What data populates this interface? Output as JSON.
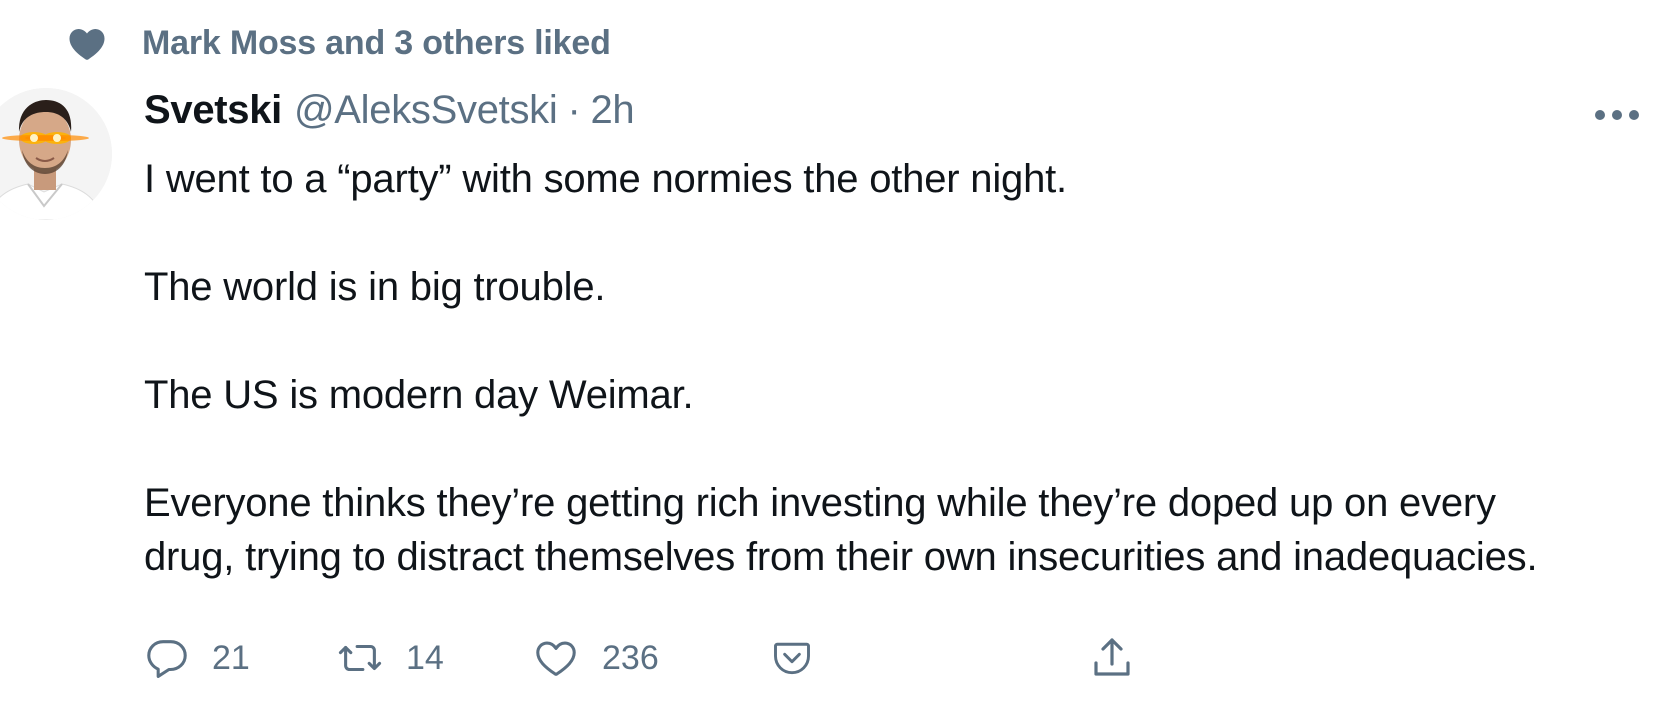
{
  "social_context": {
    "icon": "heart-icon",
    "text": "Mark Moss and 3 others liked"
  },
  "author": {
    "display_name": "Svetski",
    "handle": "@AleksSvetski",
    "separator": "·",
    "time": "2h"
  },
  "tweet": {
    "paragraphs": [
      "I went to a “party” with some normies the other night.",
      "The world is in big trouble.",
      "The US is modern day Weimar."
    ],
    "last_paragraph_lines": [
      "Everyone thinks they’re getting rich investing while they’re doped up on every",
      "drug, trying to distract themselves from their own insecurities and inadequacies."
    ]
  },
  "actions": {
    "reply": {
      "icon": "reply-icon",
      "count": "21"
    },
    "retweet": {
      "icon": "retweet-icon",
      "count": "14"
    },
    "like": {
      "icon": "heart-outline-icon",
      "count": "236"
    },
    "save": {
      "icon": "pocket-icon"
    },
    "share": {
      "icon": "share-icon"
    }
  },
  "colors": {
    "secondary_text": "#5b7083",
    "primary_text": "#0f1419",
    "icon": "#5b7083"
  }
}
